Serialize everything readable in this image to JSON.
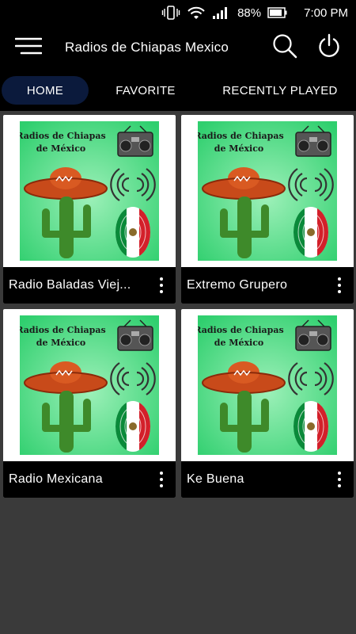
{
  "status_bar": {
    "battery": "88%",
    "time": "7:00 PM"
  },
  "app_bar": {
    "title": "Radios de Chiapas Mexico"
  },
  "tabs": [
    {
      "label": "HOME",
      "active": true
    },
    {
      "label": "FAVORITE",
      "active": false
    },
    {
      "label": "RECENTLY PLAYED",
      "active": false
    }
  ],
  "cover": {
    "line1": "Radios de Chiapas",
    "line2": "de México"
  },
  "stations": [
    {
      "name": "Radio Baladas Viej..."
    },
    {
      "name": "Extremo Grupero"
    },
    {
      "name": "Radio Mexicana"
    },
    {
      "name": "Ke Buena"
    }
  ],
  "colors": {
    "accent": "#0b1a3c",
    "background": "#3a3a3a",
    "cover_green": "#3dd47a"
  }
}
